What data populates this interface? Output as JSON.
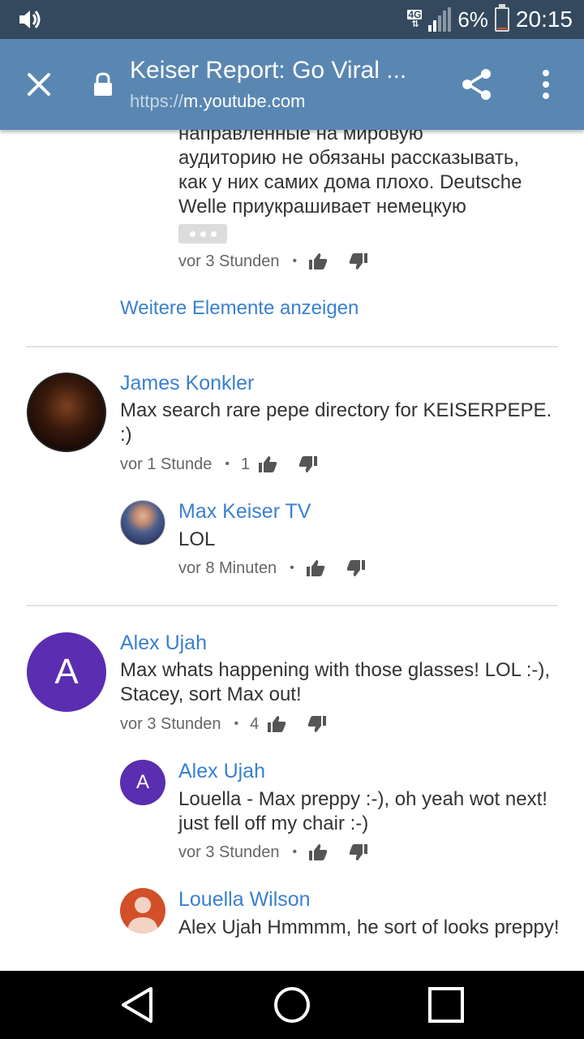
{
  "status_bar": {
    "network": "4G",
    "battery": "6%",
    "time": "20:15",
    "battery_level": 0.06,
    "icons": [
      "volume-icon",
      "signal-icon",
      "battery-icon"
    ]
  },
  "toolbar": {
    "title": "Keiser Report: Go Viral ...",
    "url_scheme": "https://",
    "url_host": "m.youtube.com",
    "icons": [
      "close-icon",
      "lock-icon",
      "share-icon",
      "more-vert-icon"
    ]
  },
  "partial_comment": {
    "text_lines": [
      "направленные на мировую",
      "аудиторию не обязаны рассказывать,",
      "как у них самих дома плохо. Deutsche",
      "Welle приукрашивает немецкую"
    ],
    "time": "vor 3 Stunden"
  },
  "show_more_label": "Weitere Elemente anzeigen",
  "threads": [
    {
      "author": "James Konkler",
      "text": "Max search rare pepe directory for KEISERPEPE. :)",
      "time": "vor 1 Stunde",
      "likes": "1",
      "replies": [
        {
          "author": "Max Keiser TV",
          "text": "LOL",
          "time": "vor 8 Minuten"
        }
      ]
    },
    {
      "author": "Alex Ujah",
      "avatar_letter": "A",
      "text": "Max whats happening with those glasses! LOL :-), Stacey, sort Max out!",
      "time": "vor 3 Stunden",
      "likes": "4",
      "replies": [
        {
          "author": "Alex Ujah",
          "avatar_letter": "A",
          "text": "Louella - Max preppy :-), oh yeah wot next! just fell off my chair :-)",
          "time": "vor 3 Stunden"
        },
        {
          "author": "Louella Wilson",
          "text": "Alex Ujah Hmmmm, he sort of looks preppy!"
        }
      ]
    }
  ],
  "colors": {
    "status_bar": "#34495e",
    "toolbar": "#5a87b2",
    "link": "#3a80d0",
    "avatar_purple": "#5b2db0",
    "avatar_orange": "#d1502a"
  }
}
